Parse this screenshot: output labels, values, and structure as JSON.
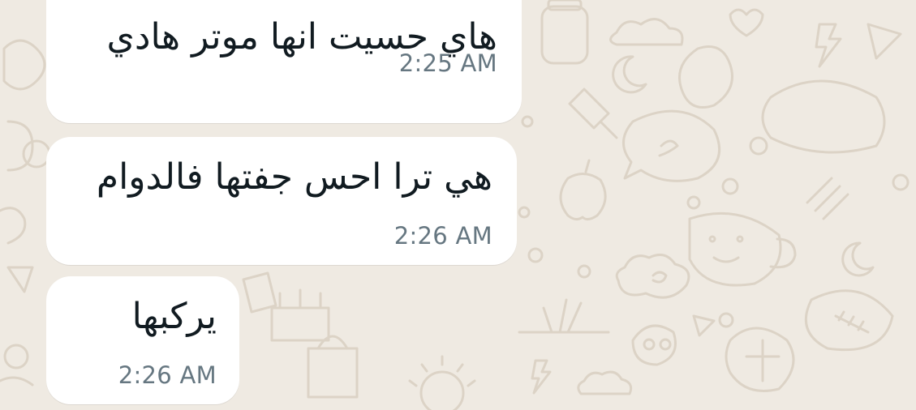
{
  "conversation": {
    "messages": [
      {
        "text": "هاي حسيت انها موتر هادي",
        "time": "2:25 AM"
      },
      {
        "text": "هي ترا احس جفتها فالدوام",
        "time": "2:26 AM"
      },
      {
        "text": "يركبها",
        "time": "2:26 AM"
      }
    ]
  },
  "colors": {
    "wallpaper": "#efeae2",
    "doodle": "#dcd3c6",
    "bubble": "#ffffff",
    "message_text": "#111b21",
    "timestamp": "#667781"
  }
}
